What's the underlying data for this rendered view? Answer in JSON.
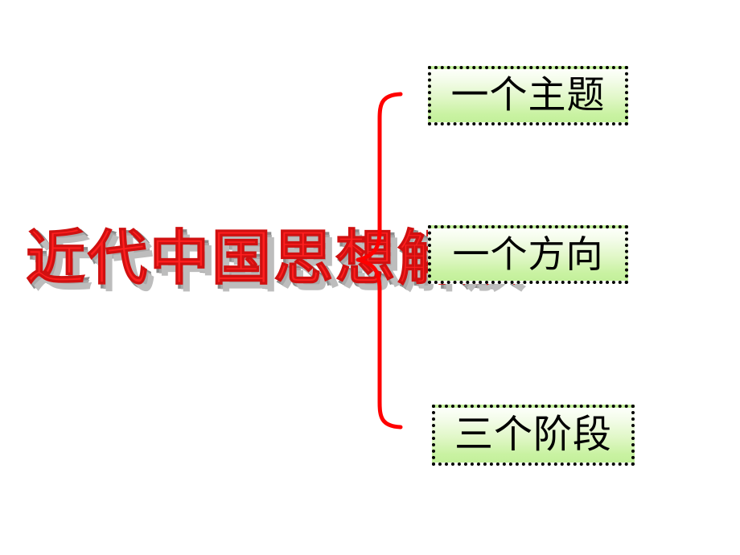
{
  "slide": {
    "background_color": "#ffffff",
    "title": {
      "text": "近代中国思想解放",
      "fill_color": "#ff0000",
      "shadow_color": "#808080",
      "style": "wordart-3d-extrusion"
    },
    "connector": {
      "name": "right-opening-curly-brace",
      "color": "#ff0000",
      "stroke_width": 5
    },
    "boxes": [
      {
        "id": "theme",
        "label": "一个主题",
        "text_color": "#000000",
        "border_color": "#000000",
        "border_style": "dotted",
        "gradient_from": "#ffffff",
        "gradient_to": "#c3f09b"
      },
      {
        "id": "direction",
        "label": "一个方向",
        "text_color": "#000000",
        "border_color": "#000000",
        "border_style": "dotted",
        "gradient_from": "#ffffff",
        "gradient_to": "#c3f09b"
      },
      {
        "id": "stages",
        "label": "三个阶段",
        "text_color": "#000000",
        "border_color": "#000000",
        "border_style": "dotted",
        "gradient_from": "#ffffff",
        "gradient_to": "#c3f09b"
      }
    ]
  }
}
